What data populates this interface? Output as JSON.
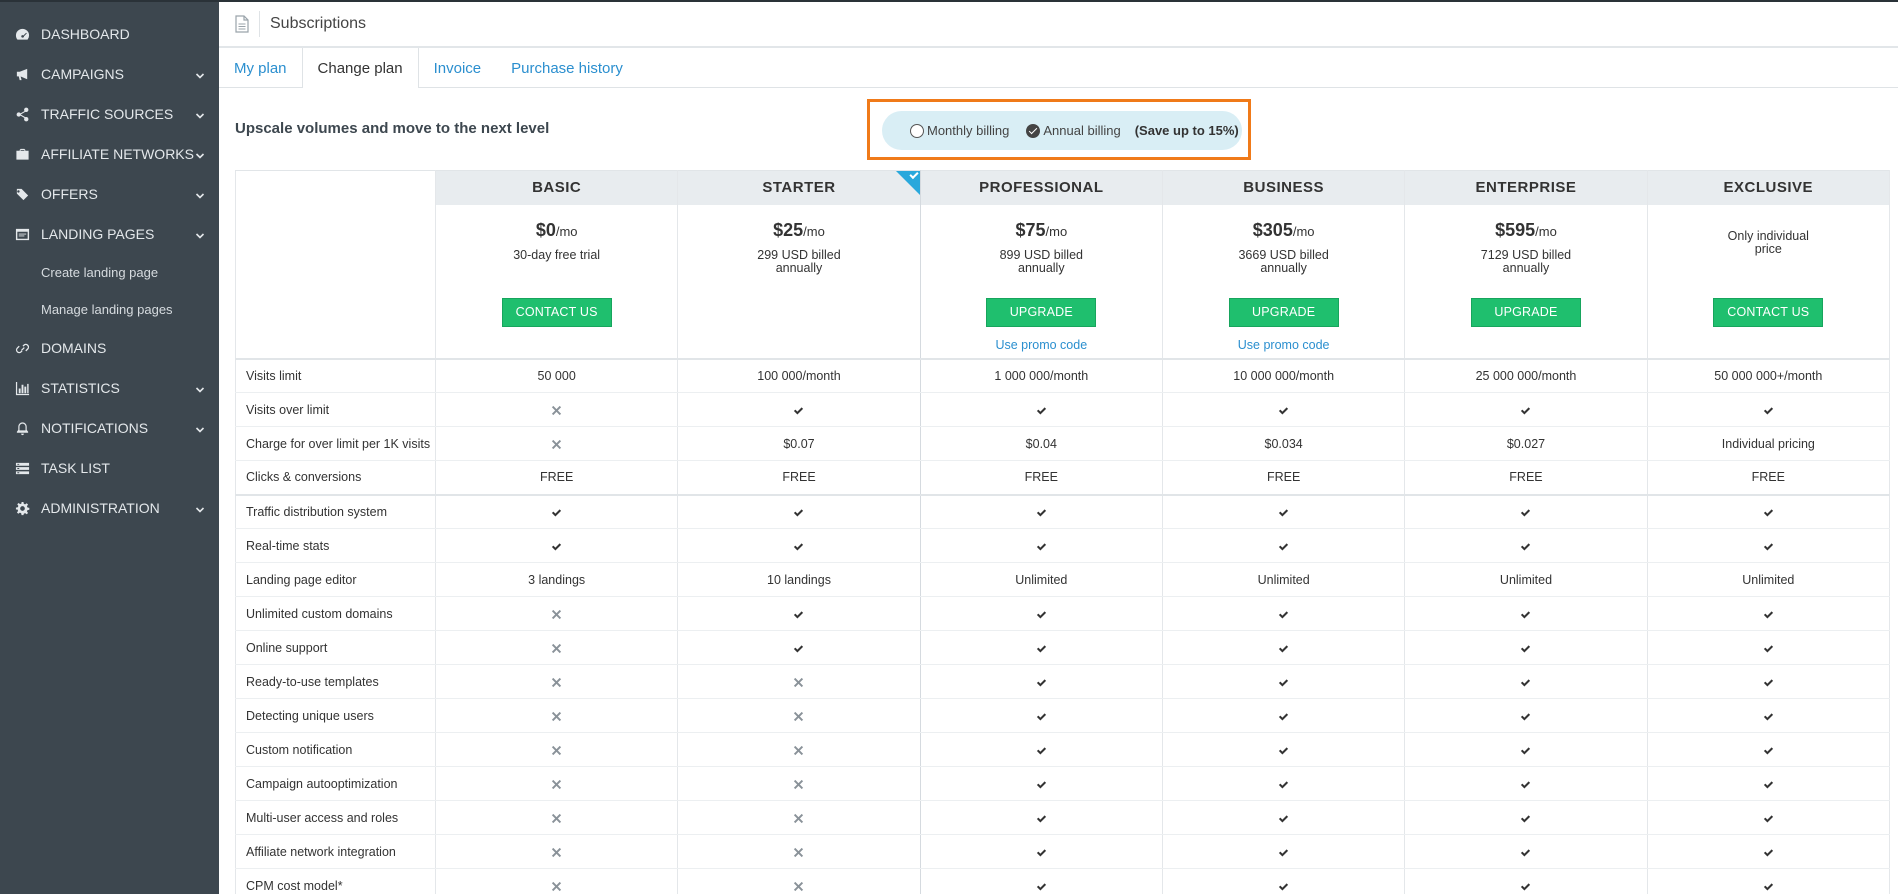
{
  "sidebar": {
    "items": [
      {
        "label": "DASHBOARD",
        "icon": "dashboard-icon",
        "chevron": false
      },
      {
        "label": "CAMPAIGNS",
        "icon": "megaphone-icon",
        "chevron": true
      },
      {
        "label": "TRAFFIC SOURCES",
        "icon": "share-icon",
        "chevron": true
      },
      {
        "label": "AFFILIATE NETWORKS",
        "icon": "briefcase-icon",
        "chevron": true
      },
      {
        "label": "OFFERS",
        "icon": "tags-icon",
        "chevron": true
      },
      {
        "label": "LANDING PAGES",
        "icon": "landing-page-icon",
        "chevron": true
      },
      {
        "label": "DOMAINS",
        "icon": "link-icon",
        "chevron": false
      },
      {
        "label": "STATISTICS",
        "icon": "bar-chart-icon",
        "chevron": true
      },
      {
        "label": "NOTIFICATIONS",
        "icon": "bell-icon",
        "chevron": true
      },
      {
        "label": "TASK LIST",
        "icon": "task-list-icon",
        "chevron": false
      },
      {
        "label": "ADMINISTRATION",
        "icon": "gear-icon",
        "chevron": true
      }
    ],
    "subitems": [
      "Create landing page",
      "Manage landing pages"
    ]
  },
  "header": {
    "title": "Subscriptions",
    "icon": "document-icon"
  },
  "tabs": [
    "My plan",
    "Change plan",
    "Invoice",
    "Purchase history"
  ],
  "active_tab": "Change plan",
  "headline": "Upscale volumes and move to the next level",
  "billing": {
    "monthly": "Monthly billing",
    "annual": "Annual billing",
    "save": "(Save up to 15%)",
    "selected": "annual",
    "highlight_color": "#f07a19"
  },
  "plans": [
    {
      "name": "BASIC",
      "price": "$0",
      "per": "/mo",
      "billed": "30-day free trial",
      "button": "CONTACT US",
      "promo": ""
    },
    {
      "name": "STARTER",
      "price": "$25",
      "per": "/mo",
      "billed": "299 USD billed annually",
      "button": "",
      "promo": ""
    },
    {
      "name": "PROFESSIONAL",
      "price": "$75",
      "per": "/mo",
      "billed": "899 USD billed annually",
      "button": "UPGRADE",
      "promo": "Use promo code"
    },
    {
      "name": "BUSINESS",
      "price": "$305",
      "per": "/mo",
      "billed": "3669 USD billed annually",
      "button": "UPGRADE",
      "promo": "Use promo code"
    },
    {
      "name": "ENTERPRISE",
      "price": "$595",
      "per": "/mo",
      "billed": "7129 USD billed annually",
      "button": "UPGRADE",
      "promo": ""
    },
    {
      "name": "EXCLUSIVE",
      "price": "",
      "per": "",
      "billed": "Only individual price",
      "button": "CONTACT US",
      "promo": ""
    }
  ],
  "features": [
    {
      "name": "Visits limit",
      "values": [
        "50 000",
        "100 000/month",
        "1 000 000/month",
        "10 000 000/month",
        "25 000 000/month",
        "50 000 000+/month"
      ],
      "sep": false
    },
    {
      "name": "Visits over limit",
      "values": [
        "x",
        "v",
        "v",
        "v",
        "v",
        "v"
      ],
      "sep": false
    },
    {
      "name": "Charge for over limit per 1K visits",
      "values": [
        "x",
        "$0.07",
        "$0.04",
        "$0.034",
        "$0.027",
        "Individual pricing"
      ],
      "sep": false
    },
    {
      "name": "Clicks & conversions",
      "values": [
        "FREE",
        "FREE",
        "FREE",
        "FREE",
        "FREE",
        "FREE"
      ],
      "sep": true
    },
    {
      "name": "Traffic distribution system",
      "values": [
        "v",
        "v",
        "v",
        "v",
        "v",
        "v"
      ],
      "sep": false
    },
    {
      "name": "Real-time stats",
      "values": [
        "v",
        "v",
        "v",
        "v",
        "v",
        "v"
      ],
      "sep": false
    },
    {
      "name": "Landing page editor",
      "values": [
        "3 landings",
        "10 landings",
        "Unlimited",
        "Unlimited",
        "Unlimited",
        "Unlimited"
      ],
      "sep": false
    },
    {
      "name": "Unlimited custom domains",
      "values": [
        "x",
        "v",
        "v",
        "v",
        "v",
        "v"
      ],
      "sep": false
    },
    {
      "name": "Online support",
      "values": [
        "x",
        "v",
        "v",
        "v",
        "v",
        "v"
      ],
      "sep": false
    },
    {
      "name": "Ready-to-use templates",
      "values": [
        "x",
        "x",
        "v",
        "v",
        "v",
        "v"
      ],
      "sep": false
    },
    {
      "name": "Detecting unique users",
      "values": [
        "x",
        "x",
        "v",
        "v",
        "v",
        "v"
      ],
      "sep": false
    },
    {
      "name": "Custom notification",
      "values": [
        "x",
        "x",
        "v",
        "v",
        "v",
        "v"
      ],
      "sep": false
    },
    {
      "name": "Campaign autooptimization",
      "values": [
        "x",
        "x",
        "v",
        "v",
        "v",
        "v"
      ],
      "sep": false
    },
    {
      "name": "Multi-user access and roles",
      "values": [
        "x",
        "x",
        "v",
        "v",
        "v",
        "v"
      ],
      "sep": false
    },
    {
      "name": "Affiliate network integration",
      "values": [
        "x",
        "x",
        "v",
        "v",
        "v",
        "v"
      ],
      "sep": false
    },
    {
      "name": "CPM cost model*",
      "values": [
        "x",
        "x",
        "v",
        "v",
        "v",
        "v"
      ],
      "sep": false
    }
  ],
  "current_plan": "STARTER",
  "colors": {
    "sidebar": "#3d474f",
    "button": "#1fbf6e",
    "link": "#2b8fcf",
    "billing_pill": "#d9eef5",
    "current_flag": "#29a8dc"
  }
}
